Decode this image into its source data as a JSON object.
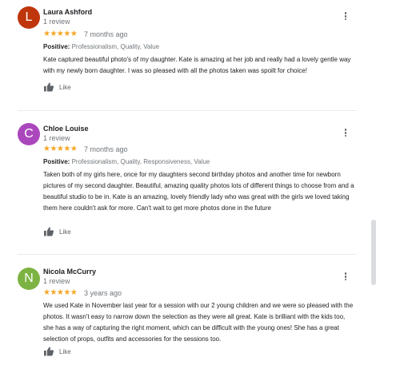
{
  "reviews": [
    {
      "avatar_letter": "L",
      "avatar_color": "#bf360c",
      "name": "Laura Ashford",
      "review_count": "1 review",
      "stars": "★★★★★",
      "time_ago": "7 months ago",
      "positive_label": "Positive:",
      "positive_values": "Professionalism, Quality, Value",
      "text": "Kate captured beautiful photo's of my daughter. Kate is amazing at her job and really had a lovely gentle way with my newly born daughter. I was so pleased with all the photos taken was spoilt for choice!",
      "like_label": "Like"
    },
    {
      "avatar_letter": "C",
      "avatar_color": "#ab47bc",
      "name": "Chloe Louise",
      "review_count": "1 review",
      "stars": "★★★★★",
      "time_ago": "7 months ago",
      "positive_label": "Positive:",
      "positive_values": "Professionalism, Quality, Responsiveness, Value",
      "text": "Taken both of my girls here, once for my daughters second birthday photos and another time for newborn pictures of my second daughter. Beautiful, amazing quality photos lots of different things to choose from and a beautiful studio to be in. Kate is an amazing, lovely friendly lady who was great with the girls we loved taking them here couldn't ask for more. Can't wait to get more photos done in the future",
      "like_label": "Like"
    },
    {
      "avatar_letter": "N",
      "avatar_color": "#7cb342",
      "name": "Nicola McCurry",
      "review_count": "1 review",
      "stars": "★★★★★",
      "time_ago": "3 years ago",
      "text": "We used Kate in November last year for a session with our 2 young children and we were so pleased with the photos. It wasn't easy to narrow down the selection as they were all great. Kate is brilliant with the kids too, she has a way of capturing the right moment, which can be difficult with the young ones! She has a great selection of props, outfits and accessories for the sessions too.",
      "like_label": "Like"
    }
  ],
  "rating": {
    "value": 5,
    "max": 5
  }
}
